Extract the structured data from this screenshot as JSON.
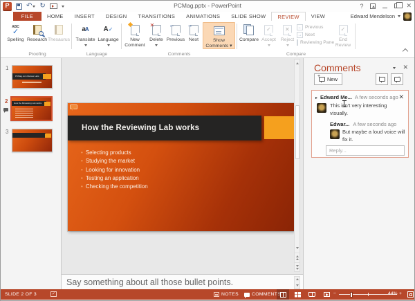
{
  "titlebar": {
    "title": "PCMag.pptx - PowerPoint",
    "help_icon": "?",
    "ppt_letter": "P"
  },
  "user": {
    "name": "Edward Mendelson"
  },
  "tabs": [
    "FILE",
    "HOME",
    "INSERT",
    "DESIGN",
    "TRANSITIONS",
    "ANIMATIONS",
    "SLIDE SHOW",
    "REVIEW",
    "VIEW"
  ],
  "icons": {
    "abc": "ABC",
    "check": "✓",
    "cross": "✕",
    "arrow_left": "←",
    "arrow_right": "→",
    "undo": "↶",
    "redo": "↻",
    "close": "✕",
    "translate_lower": "a",
    "translate_upper": "A",
    "language_letter": "A",
    "plus": "+",
    "marker": "▸"
  },
  "ribbon": {
    "proofing": {
      "label": "Proofing",
      "spelling": "Spelling",
      "research": "Research",
      "thesaurus": "Thesaurus"
    },
    "language": {
      "label": "Language",
      "translate": "Translate",
      "language": "Language"
    },
    "comments": {
      "label": "Comments",
      "new_1": "New",
      "new_2": "Comment",
      "delete": "Delete",
      "previous": "Previous",
      "next": "Next",
      "show_1": "Show",
      "show_2": "Comments ▾"
    },
    "compare": {
      "label": "Compare",
      "compare": "Compare",
      "accept": "Accept",
      "reject": "Reject",
      "previous": "Previous",
      "next": "Next",
      "reviewing_pane": "Reviewing Pane",
      "end_1": "End",
      "end_2": "Review"
    }
  },
  "thumbnails": {
    "num1": "1",
    "num2": "2",
    "num3": "3",
    "slide1_title": "PCMag.com Review Labs"
  },
  "slide": {
    "title": "How the Reviewing Lab works",
    "bullets": [
      "Selecting products",
      "Studying the market",
      "Looking for innovation",
      "Testing an application",
      "Checking the competition"
    ]
  },
  "comments_pane": {
    "title": "Comments",
    "new_button": "New",
    "card": {
      "author": "Edward Me...",
      "time": "A few seconds ago",
      "text": "This isn't very interesting visually.",
      "reply_author": "Edwar...",
      "reply_time": "A few seconds ago",
      "reply_text": "But maybe a loud voice will fix it.",
      "reply_placeholder": "Reply..."
    }
  },
  "notes": {
    "text": "Say something about all those bullet points."
  },
  "statusbar": {
    "slide_indicator": "SLIDE 2 OF 3",
    "notes": "NOTES",
    "comments": "COMMENTS",
    "zoom_out": "−",
    "zoom_in": "+",
    "zoom_level": "44%"
  }
}
